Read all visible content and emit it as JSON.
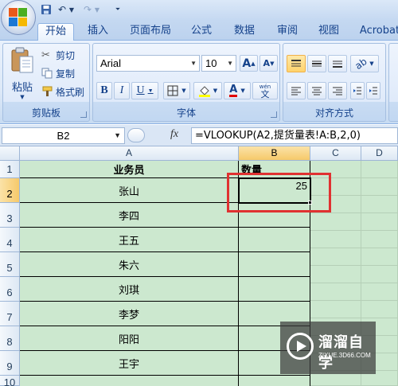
{
  "quick_access": {
    "undo": "↶",
    "redo": "↷",
    "save": "💾"
  },
  "tabs": [
    "开始",
    "插入",
    "页面布局",
    "公式",
    "数据",
    "审阅",
    "视图",
    "Acrobat"
  ],
  "ribbon": {
    "clipboard": {
      "paste": "粘贴",
      "cut": "剪切",
      "copy": "复制",
      "format_painter": "格式刷",
      "label": "剪贴板"
    },
    "font": {
      "name": "Arial",
      "size": "10",
      "grow": "A",
      "shrink": "A",
      "bold": "B",
      "italic": "I",
      "underline": "U",
      "phonetic": "wén",
      "phonetic_char": "文",
      "label": "字体"
    },
    "alignment": {
      "label": "对齐方式"
    }
  },
  "formula_bar": {
    "name_box": "B2",
    "fx": "fx",
    "formula": "=VLOOKUP(A2,提货量表!A:B,2,0)"
  },
  "columns": [
    "A",
    "B",
    "C",
    "D"
  ],
  "rows": [
    "1",
    "2",
    "3",
    "4",
    "5",
    "6",
    "7",
    "8",
    "9",
    "10"
  ],
  "cells": {
    "a1": "业务员",
    "b1": "数量",
    "a2": "张山",
    "b2": "25",
    "a3": "李四",
    "a4": "王五",
    "a5": "朱六",
    "a6": "刘琪",
    "a7": "李梦",
    "a8": "阳阳",
    "a9": "王宇"
  },
  "watermark": {
    "brand": "溜溜自学",
    "site": "ZIXUE.3D66.COM"
  },
  "colors": {
    "highlight": "#e03131",
    "cell_fill": "#cce8cf",
    "ribbon": "#dde9f8"
  }
}
